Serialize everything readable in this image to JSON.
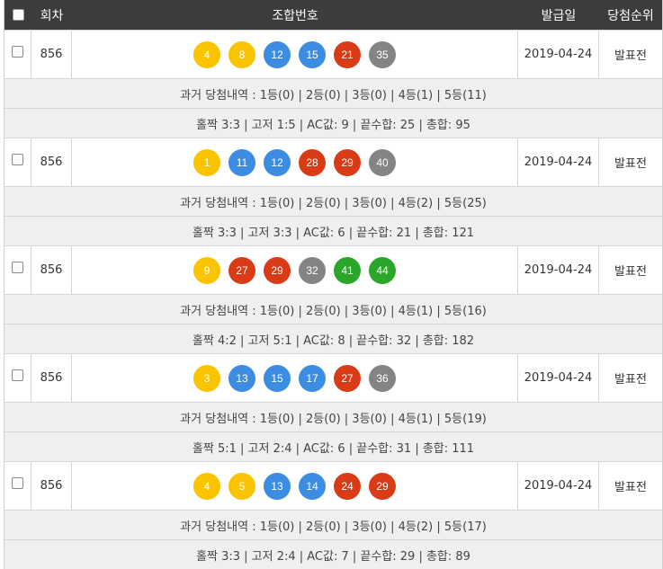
{
  "header": {
    "round": "회차",
    "numbers": "조합번호",
    "issue_date": "발급일",
    "rank": "당첨순위"
  },
  "colors": {
    "yellow": "#fbc400",
    "blue": "#3c8de2",
    "red": "#da3b16",
    "gray": "#848484",
    "green": "#2aa62a"
  },
  "rows": [
    {
      "round": "856",
      "balls": [
        {
          "n": "4",
          "color": "yellow"
        },
        {
          "n": "8",
          "color": "yellow"
        },
        {
          "n": "12",
          "color": "blue"
        },
        {
          "n": "15",
          "color": "blue"
        },
        {
          "n": "21",
          "color": "red"
        },
        {
          "n": "35",
          "color": "gray"
        }
      ],
      "date": "2019-04-24",
      "rank": "발표전",
      "history": "과거 당첨내역 : 1등(0) | 2등(0) | 3등(0) | 4등(1) | 5등(11)",
      "stats": "홀짝 3:3 | 고저 1:5 | AC값: 9 | 끝수합: 25 | 총합: 95"
    },
    {
      "round": "856",
      "balls": [
        {
          "n": "1",
          "color": "yellow"
        },
        {
          "n": "11",
          "color": "blue"
        },
        {
          "n": "12",
          "color": "blue"
        },
        {
          "n": "28",
          "color": "red"
        },
        {
          "n": "29",
          "color": "red"
        },
        {
          "n": "40",
          "color": "gray"
        }
      ],
      "date": "2019-04-24",
      "rank": "발표전",
      "history": "과거 당첨내역 : 1등(0) | 2등(0) | 3등(0) | 4등(2) | 5등(25)",
      "stats": "홀짝 3:3 | 고저 3:3 | AC값: 6 | 끝수합: 21 | 총합: 121"
    },
    {
      "round": "856",
      "balls": [
        {
          "n": "9",
          "color": "yellow"
        },
        {
          "n": "27",
          "color": "red"
        },
        {
          "n": "29",
          "color": "red"
        },
        {
          "n": "32",
          "color": "gray"
        },
        {
          "n": "41",
          "color": "green"
        },
        {
          "n": "44",
          "color": "green"
        }
      ],
      "date": "2019-04-24",
      "rank": "발표전",
      "history": "과거 당첨내역 : 1등(0) | 2등(0) | 3등(0) | 4등(1) | 5등(16)",
      "stats": "홀짝 4:2 | 고저 5:1 | AC값: 8 | 끝수합: 32 | 총합: 182"
    },
    {
      "round": "856",
      "balls": [
        {
          "n": "3",
          "color": "yellow"
        },
        {
          "n": "13",
          "color": "blue"
        },
        {
          "n": "15",
          "color": "blue"
        },
        {
          "n": "17",
          "color": "blue"
        },
        {
          "n": "27",
          "color": "red"
        },
        {
          "n": "36",
          "color": "gray"
        }
      ],
      "date": "2019-04-24",
      "rank": "발표전",
      "history": "과거 당첨내역 : 1등(0) | 2등(0) | 3등(0) | 4등(1) | 5등(19)",
      "stats": "홀짝 5:1 | 고저 2:4 | AC값: 6 | 끝수합: 31 | 총합: 111"
    },
    {
      "round": "856",
      "balls": [
        {
          "n": "4",
          "color": "yellow"
        },
        {
          "n": "5",
          "color": "yellow"
        },
        {
          "n": "13",
          "color": "blue"
        },
        {
          "n": "14",
          "color": "blue"
        },
        {
          "n": "24",
          "color": "red"
        },
        {
          "n": "29",
          "color": "red"
        }
      ],
      "date": "2019-04-24",
      "rank": "발표전",
      "history": "과거 당첨내역 : 1등(0) | 2등(0) | 3등(0) | 4등(2) | 5등(17)",
      "stats": "홀짝 3:3 | 고저 2:4 | AC값: 7 | 끝수합: 29 | 총합: 89"
    }
  ]
}
